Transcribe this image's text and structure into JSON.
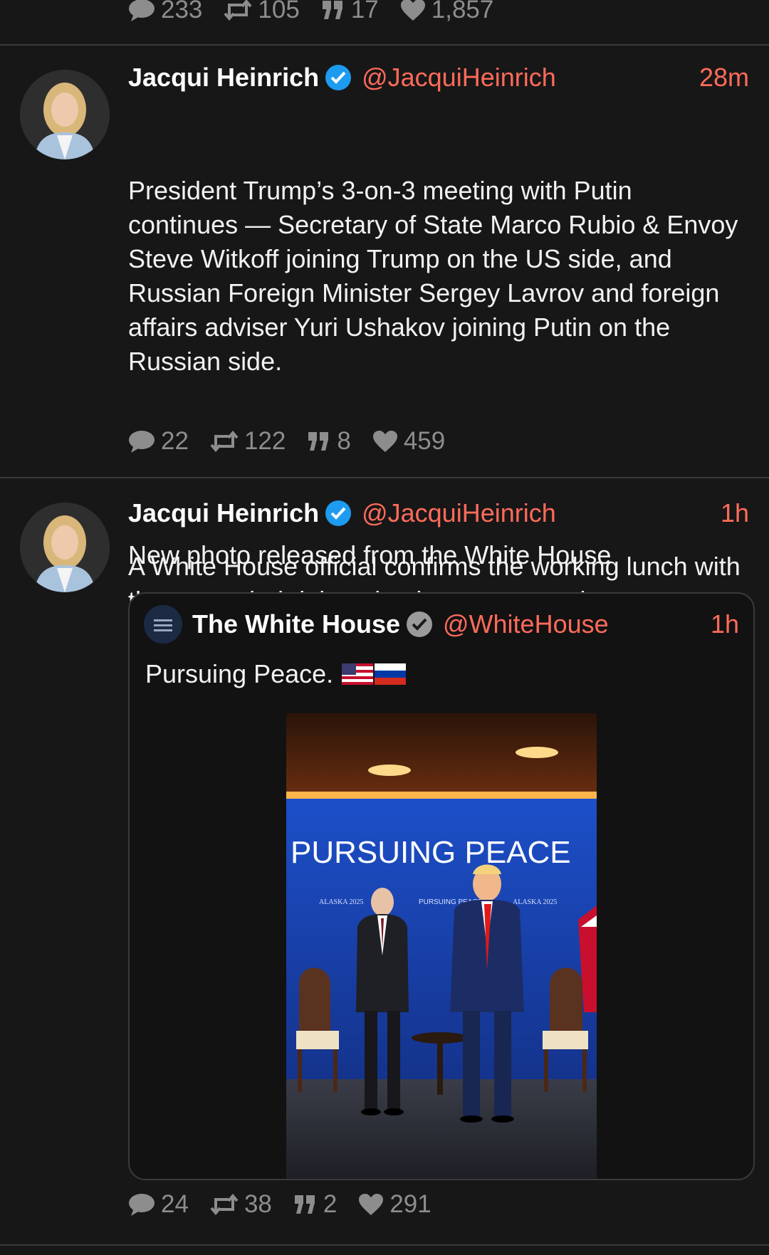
{
  "colors": {
    "background": "#171717",
    "accent": "#ff6b5a",
    "verified_blue": "#1d9bf0",
    "muted": "#8d8d8d"
  },
  "prev_tweet": {
    "replies": "233",
    "retweets": "105",
    "quotes": "17",
    "likes": "1,857"
  },
  "tweet1": {
    "name": "Jacqui Heinrich",
    "handle": "@JacquiHeinrich",
    "time": "28m",
    "text_p1": "President Trump’s 3-on-3 meeting with Putin continues — Secretary of State Marco Rubio & Envoy Steve Witkoff joining Trump on the US side, and Russian Foreign Minister Sergey Lavrov and foreign affairs adviser Yuri Ushakov joining Putin on the Russian side.",
    "text_p2": "A White House official confirms the working lunch with the expanded delegation has not started yet.",
    "stats": {
      "replies": "22",
      "retweets": "122",
      "quotes": "8",
      "likes": "459"
    }
  },
  "tweet2": {
    "name": "Jacqui Heinrich",
    "handle": "@JacquiHeinrich",
    "time": "1h",
    "text": "New photo released from the White House",
    "quote": {
      "name": "The White House",
      "handle": "@WhiteHouse",
      "time": "1h",
      "text": "Pursuing Peace.",
      "photo": {
        "backdrop_text": "PURSUING PEACE",
        "small_label_left": "ALASKA 2025",
        "small_label_center": "PURSUING PEACE",
        "small_label_right": "ALASKA 2025"
      }
    },
    "stats": {
      "replies": "24",
      "retweets": "38",
      "quotes": "2",
      "likes": "291"
    }
  }
}
